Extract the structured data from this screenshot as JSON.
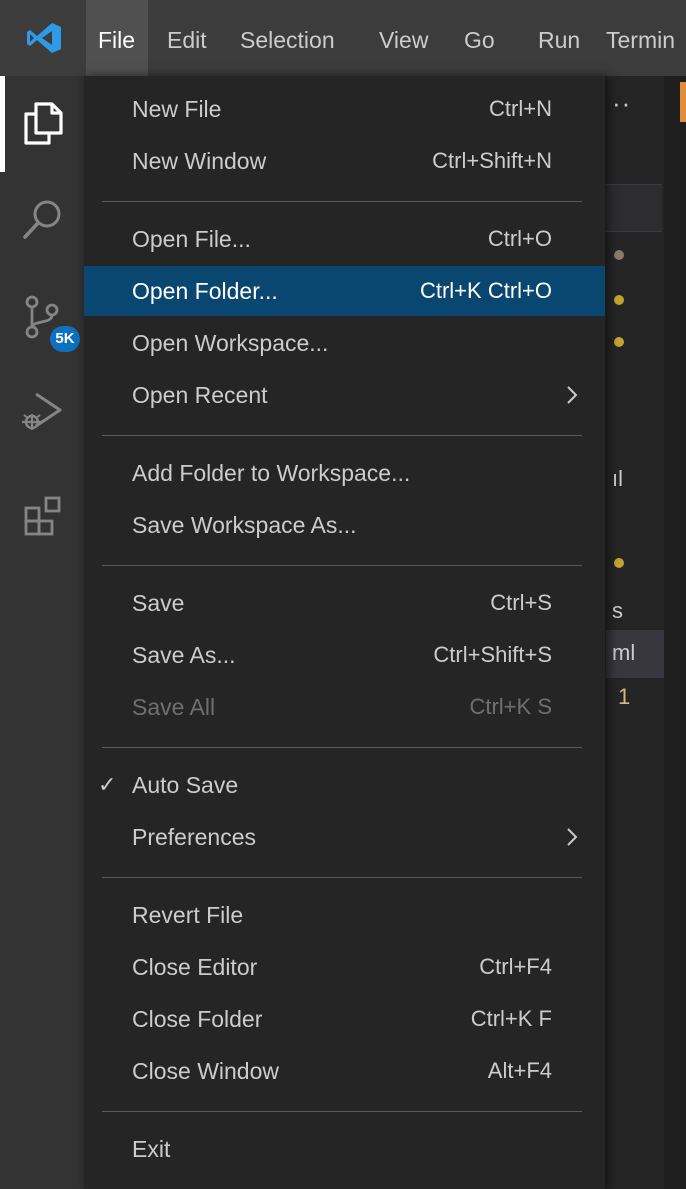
{
  "menubar": {
    "items": [
      {
        "label": "File"
      },
      {
        "label": "Edit"
      },
      {
        "label": "Selection"
      },
      {
        "label": "View"
      },
      {
        "label": "Go"
      },
      {
        "label": "Run"
      },
      {
        "label": "Termin"
      }
    ],
    "active_index": 0
  },
  "activity_bar": {
    "items": [
      {
        "icon": "explorer-icon",
        "active": true
      },
      {
        "icon": "search-icon"
      },
      {
        "icon": "source-control-icon",
        "badge": "5K"
      },
      {
        "icon": "run-debug-icon"
      },
      {
        "icon": "extensions-icon"
      }
    ]
  },
  "file_menu": {
    "groups": [
      [
        {
          "label": "New File",
          "shortcut": "Ctrl+N"
        },
        {
          "label": "New Window",
          "shortcut": "Ctrl+Shift+N"
        }
      ],
      [
        {
          "label": "Open File...",
          "shortcut": "Ctrl+O"
        },
        {
          "label": "Open Folder...",
          "shortcut": "Ctrl+K Ctrl+O",
          "highlighted": true
        },
        {
          "label": "Open Workspace..."
        },
        {
          "label": "Open Recent",
          "submenu": true
        }
      ],
      [
        {
          "label": "Add Folder to Workspace..."
        },
        {
          "label": "Save Workspace As..."
        }
      ],
      [
        {
          "label": "Save",
          "shortcut": "Ctrl+S"
        },
        {
          "label": "Save As...",
          "shortcut": "Ctrl+Shift+S"
        },
        {
          "label": "Save All",
          "shortcut": "Ctrl+K S",
          "disabled": true
        }
      ],
      [
        {
          "label": "Auto Save",
          "checked": true
        },
        {
          "label": "Preferences",
          "submenu": true
        }
      ],
      [
        {
          "label": "Revert File"
        },
        {
          "label": "Close Editor",
          "shortcut": "Ctrl+F4"
        },
        {
          "label": "Close Folder",
          "shortcut": "Ctrl+K F"
        },
        {
          "label": "Close Window",
          "shortcut": "Alt+F4"
        }
      ],
      [
        {
          "label": "Exit"
        }
      ]
    ]
  },
  "background": {
    "sidebar_peek_texts": [
      "ıl",
      "s",
      "ml",
      "1"
    ]
  },
  "colors": {
    "menubar_bg": "#3c3c3c",
    "menu_bg": "#252526",
    "highlight_bg": "#094771",
    "separator": "#5a5a5a",
    "badge_bg": "#0e70c0",
    "modified_dot": "#c5a332"
  },
  "check_glyph": "✓"
}
